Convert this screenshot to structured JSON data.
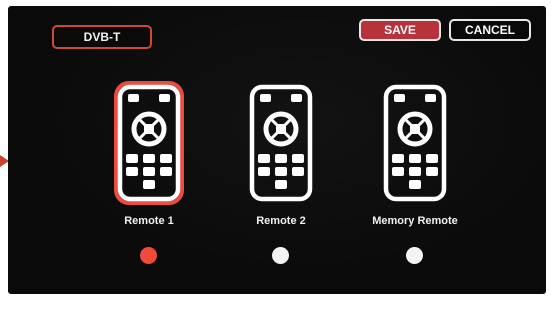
{
  "header": {
    "source_label": "DVB-T",
    "save_label": "SAVE",
    "cancel_label": "CANCEL"
  },
  "remotes": [
    {
      "label": "Remote 1",
      "selected": true,
      "icon": "remote-control-icon"
    },
    {
      "label": "Remote 2",
      "selected": false,
      "icon": "remote-control-icon"
    },
    {
      "label": "Memory Remote",
      "selected": false,
      "icon": "remote-control-icon"
    }
  ],
  "colors": {
    "accent": "#d0473c",
    "selected_dot": "#ef4a3c",
    "save_fill": "#b8323a",
    "background": "#0a0a0a"
  }
}
